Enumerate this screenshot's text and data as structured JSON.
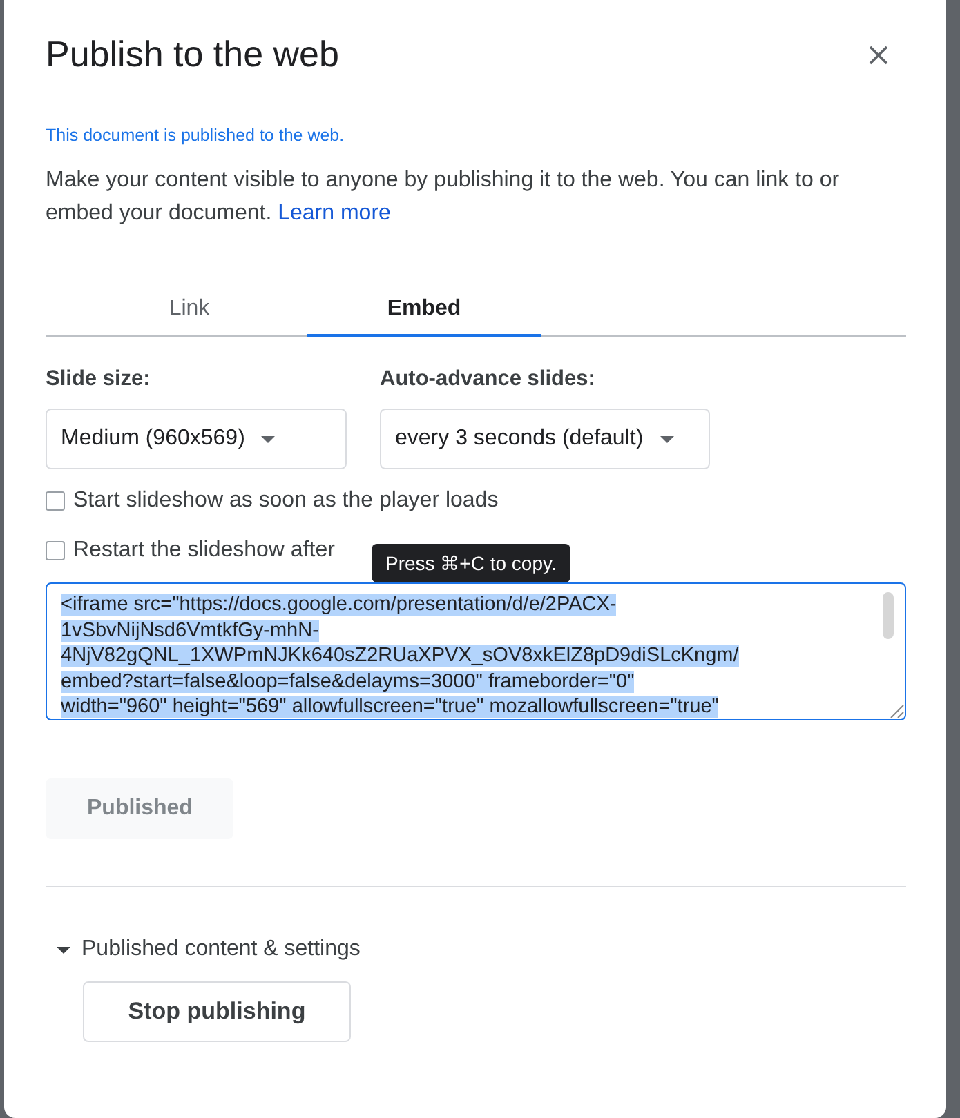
{
  "dialog": {
    "title": "Publish to the web",
    "status": "This document is published to the web.",
    "description": "Make your content visible to anyone by publishing it to the web. You can link to or embed your document.",
    "learn_more": "Learn more"
  },
  "tabs": [
    {
      "label": "Link",
      "selected": false
    },
    {
      "label": "Embed",
      "selected": true
    }
  ],
  "slide_size": {
    "label": "Slide size:",
    "value": "Medium (960x569)"
  },
  "auto_advance": {
    "label": "Auto-advance slides:",
    "value": "every 3 seconds (default)"
  },
  "options": [
    {
      "label": "Start slideshow as soon as the player loads",
      "checked": false
    },
    {
      "label": "Restart the slideshow after",
      "checked": false
    }
  ],
  "tooltip": "Press ⌘+C to copy.",
  "embed_code": {
    "lines": [
      "<iframe src=\"https://docs.google.com/presentation/d/e/2PACX-",
      "1vSbvNijNsd6VmtkfGy-mhN-",
      "4NjV82gQNL_1XWPmNJKk640sZ2RUaXPVX_sOV8xkElZ8pD9diSLcKngm/",
      "embed?start=false&loop=false&delayms=3000\" frameborder=\"0\"",
      "width=\"960\" height=\"569\" allowfullscreen=\"true\" mozallowfullscreen=\"true\""
    ],
    "selected": true
  },
  "publish_button": {
    "label": "Published",
    "disabled": true
  },
  "settings": {
    "label": "Published content & settings",
    "expanded": true,
    "stop_button": "Stop publishing"
  }
}
